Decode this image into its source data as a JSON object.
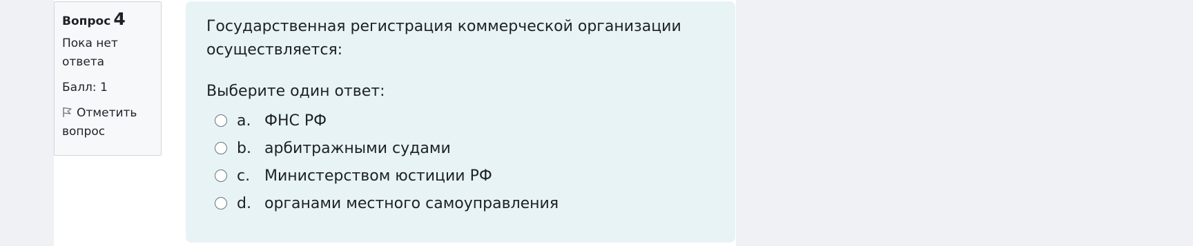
{
  "question_info": {
    "label": "Вопрос",
    "number": "4",
    "state": "Пока нет ответа",
    "grade": "Балл: 1",
    "flag_label": "Отметить вопрос"
  },
  "question": {
    "text": "Государственная регистрация коммерческой организации осуществляется:",
    "prompt": "Выберите один ответ:",
    "answers": [
      {
        "letter": "a.",
        "text": "ФНС РФ"
      },
      {
        "letter": "b.",
        "text": "арбитражными судами"
      },
      {
        "letter": "c.",
        "text": "Министерством юстиции РФ"
      },
      {
        "letter": "d.",
        "text": "органами местного самоуправления"
      }
    ]
  },
  "colors": {
    "page_bg": "#eff1f5",
    "question_bg": "#e7f3f5",
    "info_bg": "#f7f8fa",
    "text": "#1d2125"
  }
}
